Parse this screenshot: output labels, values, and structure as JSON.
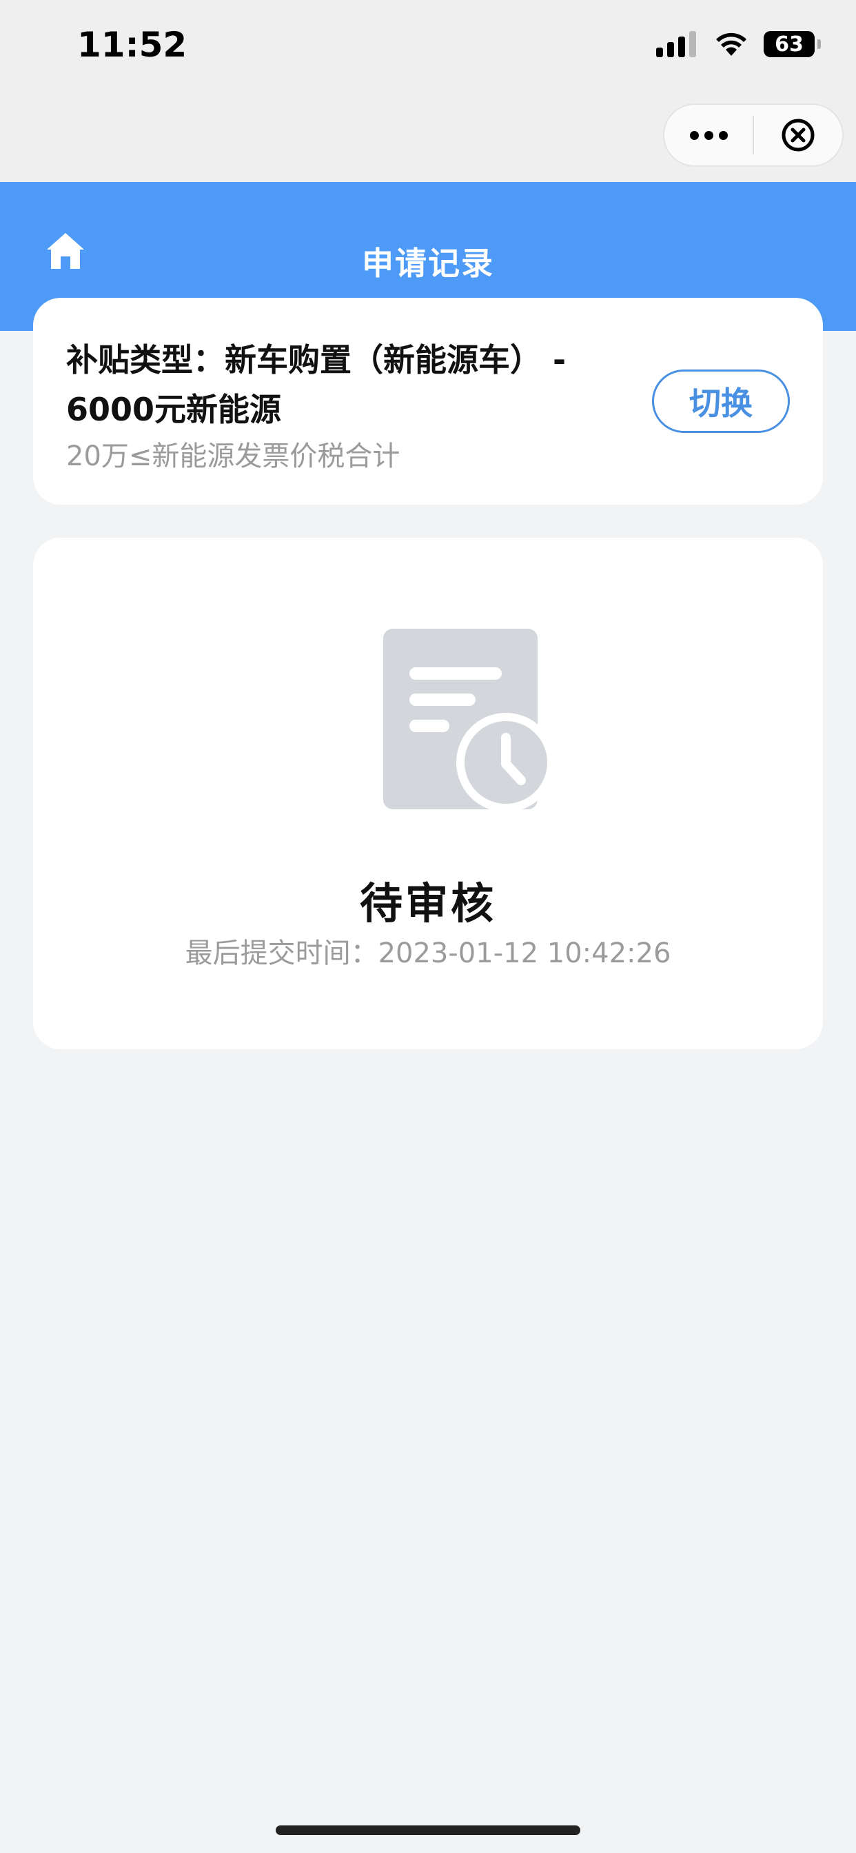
{
  "status_bar": {
    "time": "11:52",
    "battery": "63",
    "icons": [
      "cellular-signal-icon",
      "wifi-icon",
      "battery-icon"
    ]
  },
  "capsule": {
    "icons": [
      "more-dots-icon",
      "close-circle-icon"
    ]
  },
  "header": {
    "title": "申请记录",
    "home_icon": "home-icon",
    "background": "#4d9bf6"
  },
  "subsidy": {
    "type_line1": "补贴类型：新车购置（新能源车） -",
    "type_line2": "6000元新能源",
    "description": "20万≤新能源发票价税合计",
    "switch_label": "切换"
  },
  "application_status": {
    "illustration_icon": "document-clock-icon",
    "status": "待审核",
    "submit_time_label": "最后提交时间：",
    "submit_time": "2023-01-12 10:42:26"
  },
  "colors": {
    "accent": "#4a90e2",
    "page_background": "#f2f3f5",
    "illustration_gray": "#d3d6db"
  }
}
